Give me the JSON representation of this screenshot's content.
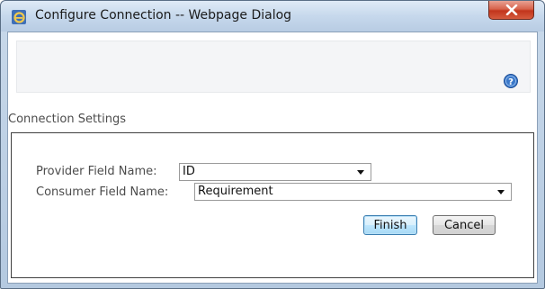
{
  "window": {
    "title": "Configure Connection -- Webpage Dialog"
  },
  "icons": {
    "app": "internet-explorer-icon",
    "close": "close-icon",
    "help": "help-icon"
  },
  "section": {
    "title": "Connection Settings"
  },
  "fields": {
    "provider": {
      "label": "Provider Field Name:",
      "value": "ID"
    },
    "consumer": {
      "label": "Consumer Field Name:",
      "value": "Requirement"
    }
  },
  "buttons": {
    "finish": "Finish",
    "cancel": "Cancel"
  },
  "colors": {
    "close_button": "#c2351c",
    "help_icon": "#3a78c9",
    "default_button_border": "#3c7fb1"
  }
}
